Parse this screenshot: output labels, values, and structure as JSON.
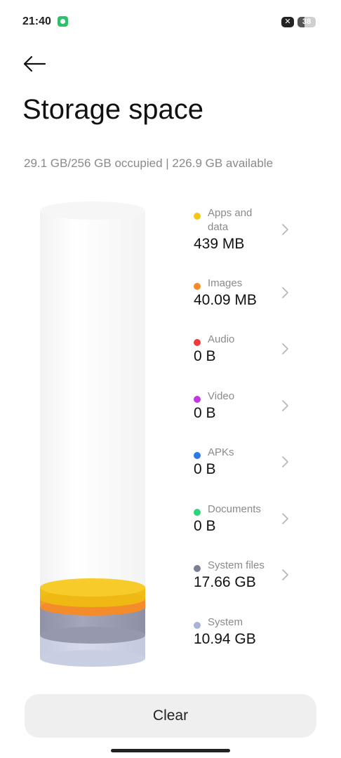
{
  "status_bar": {
    "time": "21:40",
    "close_badge": "✕",
    "battery_level": "38",
    "battery_fraction": 0.38
  },
  "header": {
    "back_icon": "arrow-left-icon",
    "title": "Storage space"
  },
  "summary": "29.1 GB/256 GB occupied | 226.9 GB available",
  "categories": [
    {
      "label": "Apps and data",
      "value": "439 MB",
      "color": "#f5c518",
      "has_chevron": true
    },
    {
      "label": "Images",
      "value": "40.09 MB",
      "color": "#f58a2a",
      "has_chevron": true
    },
    {
      "label": "Audio",
      "value": "0 B",
      "color": "#ee3b3b",
      "has_chevron": true
    },
    {
      "label": "Video",
      "value": "0 B",
      "color": "#c436e0",
      "has_chevron": true
    },
    {
      "label": "APKs",
      "value": "0 B",
      "color": "#2a7be4",
      "has_chevron": true
    },
    {
      "label": "Documents",
      "value": "0 B",
      "color": "#2ed47a",
      "has_chevron": true
    },
    {
      "label": "System files",
      "value": "17.66 GB",
      "color": "#7a7f96",
      "has_chevron": true
    },
    {
      "label": "System",
      "value": "10.94 GB",
      "color": "#a9b3d3",
      "has_chevron": false
    }
  ],
  "clear_button": "Clear",
  "colors": {
    "apps": "#f5c518",
    "images": "#f58a2a",
    "system_files": "#8e91a6",
    "system": "#c2c8dc",
    "accent_text": "#8a8a8a"
  }
}
